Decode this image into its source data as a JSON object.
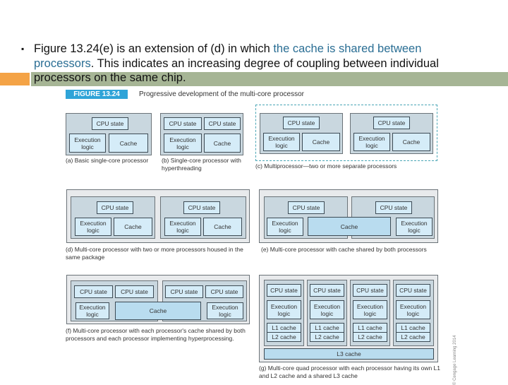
{
  "slide": {
    "bullet": {
      "part1": "Figure 13.24(e) is an extension of (d) in which ",
      "highlight1": "the cache is shared between",
      "highlight2": "processors",
      "part2": ". This indicates an increasing degree of coupling between individual",
      "line3": "processors on the same chip."
    },
    "colors": {
      "highlight": "#2a6e94",
      "accent_bar": "#a6b595",
      "orange_bar": "#f4a346",
      "figure_tag": "#2fa4d8"
    }
  },
  "figure": {
    "tag": "FIGURE 13.24",
    "title": "Progressive development of the multi-core processor",
    "labels": {
      "cpu_state": "CPU state",
      "exec": "Execution logic",
      "cache": "Cache",
      "l1": "L1 cache",
      "l2": "L2 cache",
      "l3": "L3 cache"
    },
    "captions": {
      "a": "(a) Basic single-core processor",
      "b": "(b) Single-core processor with hyperthreading",
      "c": "(c) Multiprocessor—two or more separate processors",
      "d": "(d) Multi-core processor with two or more processors housed in the same package",
      "e": "(e) Multi-core processor with cache shared by both processors",
      "f": "(f) Multi-core processor with each processor's cache shared by both processors and each processor implementing hyperprocessing.",
      "g": "(g) Multi-core quad processor with each processor having its own L1 and L2 cache and a shared L3 cache"
    },
    "copyright": "© Cengage Learning 2014"
  }
}
